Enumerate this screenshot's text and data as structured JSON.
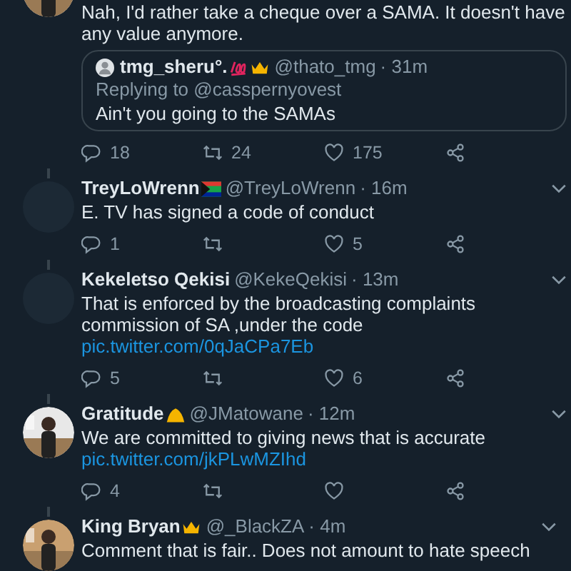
{
  "tweets": [
    {
      "avatar": {
        "kind": "picture"
      },
      "text": "Nah, I'd rather take a cheque over a SAMA. It doesn't have any value anymore.",
      "quote": {
        "name": "tmg_sheru°.",
        "badges": [
          {
            "kind": "hundred"
          },
          {
            "kind": "crown"
          }
        ],
        "handle": "@thato_tmg",
        "time": "· 31m",
        "replying": "Replying to @casspernyovest",
        "text": "Ain't you going to the SAMAs"
      },
      "actions": {
        "reply": "18",
        "retweet": "24",
        "like": "175"
      }
    },
    {
      "avatar": {
        "kind": "blank"
      },
      "name": "TreyLoWrenn",
      "badges": [
        {
          "kind": "flag"
        }
      ],
      "handle": "@TreyLoWrenn",
      "time": "· 16m",
      "text": "E. TV has signed a code of conduct",
      "actions": {
        "reply": "1",
        "like": "5"
      }
    },
    {
      "avatar": {
        "kind": "blank"
      },
      "name": "Kekeletso Qekisi",
      "handle": "@KekeQekisi",
      "time": "· 13m",
      "text": "That is enforced by the broadcasting complaints commission of SA ,under the code",
      "link": "pic.twitter.com/0qJaCPa7Eb",
      "actions": {
        "reply": "5",
        "like": "6"
      }
    },
    {
      "avatar": {
        "kind": "picture"
      },
      "name": "Gratitude",
      "badges": [
        {
          "kind": "hands"
        }
      ],
      "handle": "@JMatowane",
      "time": "· 12m",
      "text": "We are committed to giving news that is accurate",
      "link": "pic.twitter.com/jkPLwMZIhd",
      "actions": {
        "reply": "4"
      }
    },
    {
      "avatar": {
        "kind": "picture"
      },
      "name": "King Bryan",
      "badges": [
        {
          "kind": "crown"
        }
      ],
      "handle": "@_BlackZA",
      "time": "· 4m",
      "text": "Comment that is fair.. Does not amount to hate speech"
    }
  ]
}
